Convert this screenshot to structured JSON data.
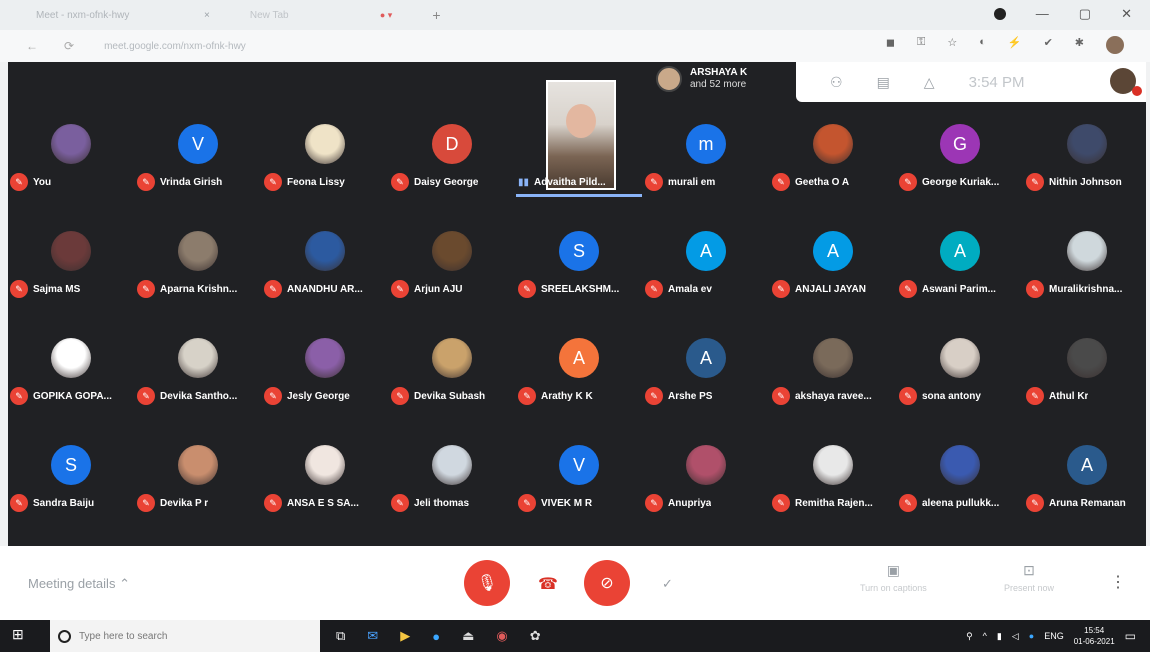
{
  "browser": {
    "tab_title": "Meet - nxm-ofnk-hwy",
    "tab2_title": "New Tab",
    "url": "meet.google.com/nxm-ofnk-hwy",
    "close_glyph": "×",
    "new_tab_glyph": "+"
  },
  "presenter": {
    "name": "ARSHAYA K",
    "sub": "and 52 more"
  },
  "meet_top": {
    "time": "3:54 PM"
  },
  "grid": {
    "tiles": [
      {
        "name": "You",
        "type": "photo",
        "color": "#7a5f9e",
        "letter": ""
      },
      {
        "name": "Vrinda Girish",
        "type": "letter",
        "color": "#1a73e8",
        "letter": "V"
      },
      {
        "name": "Feona Lissy",
        "type": "photo",
        "color": "#efe3c7",
        "letter": ""
      },
      {
        "name": "Daisy George",
        "type": "letter",
        "color": "#d84a3b",
        "letter": "D"
      },
      {
        "name": "Advaitha Pild...",
        "type": "video",
        "color": "",
        "letter": ""
      },
      {
        "name": "murali em",
        "type": "letter",
        "color": "#1a73e8",
        "letter": "m"
      },
      {
        "name": "Geetha O A",
        "type": "photo",
        "color": "#c4552f",
        "letter": ""
      },
      {
        "name": "George Kuriak...",
        "type": "letter",
        "color": "#9c36b5",
        "letter": "G"
      },
      {
        "name": "Nithin Johnson",
        "type": "photo",
        "color": "#3e4a6a",
        "letter": ""
      },
      {
        "name": "Sajma MS",
        "type": "photo",
        "color": "#6b3a3a",
        "letter": ""
      },
      {
        "name": "Aparna Krishn...",
        "type": "photo",
        "color": "#8c7c6c",
        "letter": ""
      },
      {
        "name": "ANANDHU AR...",
        "type": "photo",
        "color": "#2c5aa0",
        "letter": ""
      },
      {
        "name": "Arjun AJU",
        "type": "photo",
        "color": "#6a4a2e",
        "letter": ""
      },
      {
        "name": "SREELAKSHM...",
        "type": "letter",
        "color": "#1a73e8",
        "letter": "S"
      },
      {
        "name": "Amala ev",
        "type": "letter",
        "color": "#039be5",
        "letter": "A"
      },
      {
        "name": "ANJALI JAYAN",
        "type": "letter",
        "color": "#039be5",
        "letter": "A"
      },
      {
        "name": "Aswani Parim...",
        "type": "letter",
        "color": "#00acc1",
        "letter": "A"
      },
      {
        "name": "Muralikrishna...",
        "type": "photo",
        "color": "#cfd8dc",
        "letter": ""
      },
      {
        "name": "GOPIKA GOPA...",
        "type": "photo",
        "color": "#ffffff",
        "letter": ""
      },
      {
        "name": "Devika Santho...",
        "type": "photo",
        "color": "#d7d2c8",
        "letter": ""
      },
      {
        "name": "Jesly George",
        "type": "photo",
        "color": "#8b5fa8",
        "letter": ""
      },
      {
        "name": "Devika Subash",
        "type": "photo",
        "color": "#caa26b",
        "letter": ""
      },
      {
        "name": "Arathy K K",
        "type": "letter",
        "color": "#f4743b",
        "letter": "A"
      },
      {
        "name": "Arshe PS",
        "type": "letter",
        "color": "#2a5a8c",
        "letter": "A"
      },
      {
        "name": "akshaya ravee...",
        "type": "photo",
        "color": "#7a6a5a",
        "letter": ""
      },
      {
        "name": "sona antony",
        "type": "photo",
        "color": "#d8cfc6",
        "letter": ""
      },
      {
        "name": "Athul Kr",
        "type": "photo",
        "color": "#4a4a4a",
        "letter": ""
      },
      {
        "name": "Sandra Baiju",
        "type": "letter",
        "color": "#1a73e8",
        "letter": "S"
      },
      {
        "name": "Devika P r",
        "type": "photo",
        "color": "#c98e6e",
        "letter": ""
      },
      {
        "name": "ANSA E S SA...",
        "type": "photo",
        "color": "#f0e6e0",
        "letter": ""
      },
      {
        "name": "Jeli thomas",
        "type": "photo",
        "color": "#d0d8e0",
        "letter": ""
      },
      {
        "name": "VIVEK M R",
        "type": "letter",
        "color": "#1a73e8",
        "letter": "V"
      },
      {
        "name": "Anupriya",
        "type": "photo",
        "color": "#b0506a",
        "letter": ""
      },
      {
        "name": "Remitha Rajen...",
        "type": "photo",
        "color": "#e8e8e8",
        "letter": ""
      },
      {
        "name": "aleena pullukk...",
        "type": "photo",
        "color": "#3a5ab0",
        "letter": ""
      },
      {
        "name": "Aruna Remanan",
        "type": "letter",
        "color": "#2a5a8c",
        "letter": "A"
      }
    ]
  },
  "meetbar": {
    "details_label": "Meeting details",
    "captions_label": "Turn on captions",
    "present_label": "Present now"
  },
  "taskbar": {
    "search_placeholder": "Type here to search",
    "lang": "ENG",
    "time": "15:54",
    "date": "01-06-2021"
  },
  "colors": {
    "stage_bg": "#202124",
    "mic_off_red": "#ea4335",
    "meet_blue": "#1a73e8"
  }
}
